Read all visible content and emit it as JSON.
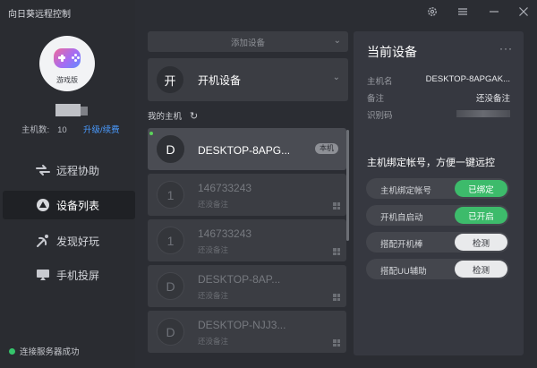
{
  "app": {
    "title": "向日葵远程控制"
  },
  "profile": {
    "avatar_label": "游戏版",
    "host_count_label": "主机数:",
    "host_count": "10",
    "upgrade_label": "升级/续费"
  },
  "nav": {
    "items": [
      {
        "label": "远程协助",
        "icon": "remote-assist-icon"
      },
      {
        "label": "设备列表",
        "icon": "device-list-icon"
      },
      {
        "label": "发现好玩",
        "icon": "discover-icon"
      },
      {
        "label": "手机投屏",
        "icon": "phone-cast-icon"
      }
    ],
    "active_index": 1
  },
  "status": {
    "text": "连接服务器成功",
    "color": "#35c46b"
  },
  "window_controls": [
    "settings-icon",
    "menu-icon",
    "minimize-icon",
    "close-icon"
  ],
  "device_actions": {
    "add_label": "添加设备",
    "boot_icon_char": "开",
    "boot_label": "开机设备"
  },
  "my_hosts": {
    "label": "我的主机"
  },
  "hosts": [
    {
      "initial": "D",
      "name": "DESKTOP-8APG...",
      "note": "",
      "badge": "本机",
      "online": true
    },
    {
      "initial": "1",
      "name": "146733243",
      "note": "还没备注",
      "badge": "",
      "online": false
    },
    {
      "initial": "1",
      "name": "146733243",
      "note": "还没备注",
      "badge": "",
      "online": false
    },
    {
      "initial": "D",
      "name": "DESKTOP-8AP...",
      "note": "还没备注",
      "badge": "",
      "online": false
    },
    {
      "initial": "D",
      "name": "DESKTOP-NJJ3...",
      "note": "还没备注",
      "badge": "",
      "online": false
    }
  ],
  "current_device": {
    "title": "当前设备",
    "more": "···",
    "hostname_label": "主机名",
    "hostname": "DESKTOP-8APGAK...",
    "note_label": "备注",
    "note": "还没备注",
    "id_label": "识别码",
    "bind_hint": "主机绑定帐号，方便一键远控",
    "features": [
      {
        "label": "主机绑定帐号",
        "button": "已绑定",
        "style": "green"
      },
      {
        "label": "开机自启动",
        "button": "已开启",
        "style": "green"
      },
      {
        "label": "搭配开机棒",
        "button": "检测",
        "style": "light"
      },
      {
        "label": "搭配UU辅助",
        "button": "检测",
        "style": "light"
      }
    ]
  },
  "colors": {
    "accent_green": "#3dbb6b",
    "link_blue": "#4a9bff",
    "sidebar_bg": "#2a2c31",
    "main_bg": "#2b2d33"
  }
}
